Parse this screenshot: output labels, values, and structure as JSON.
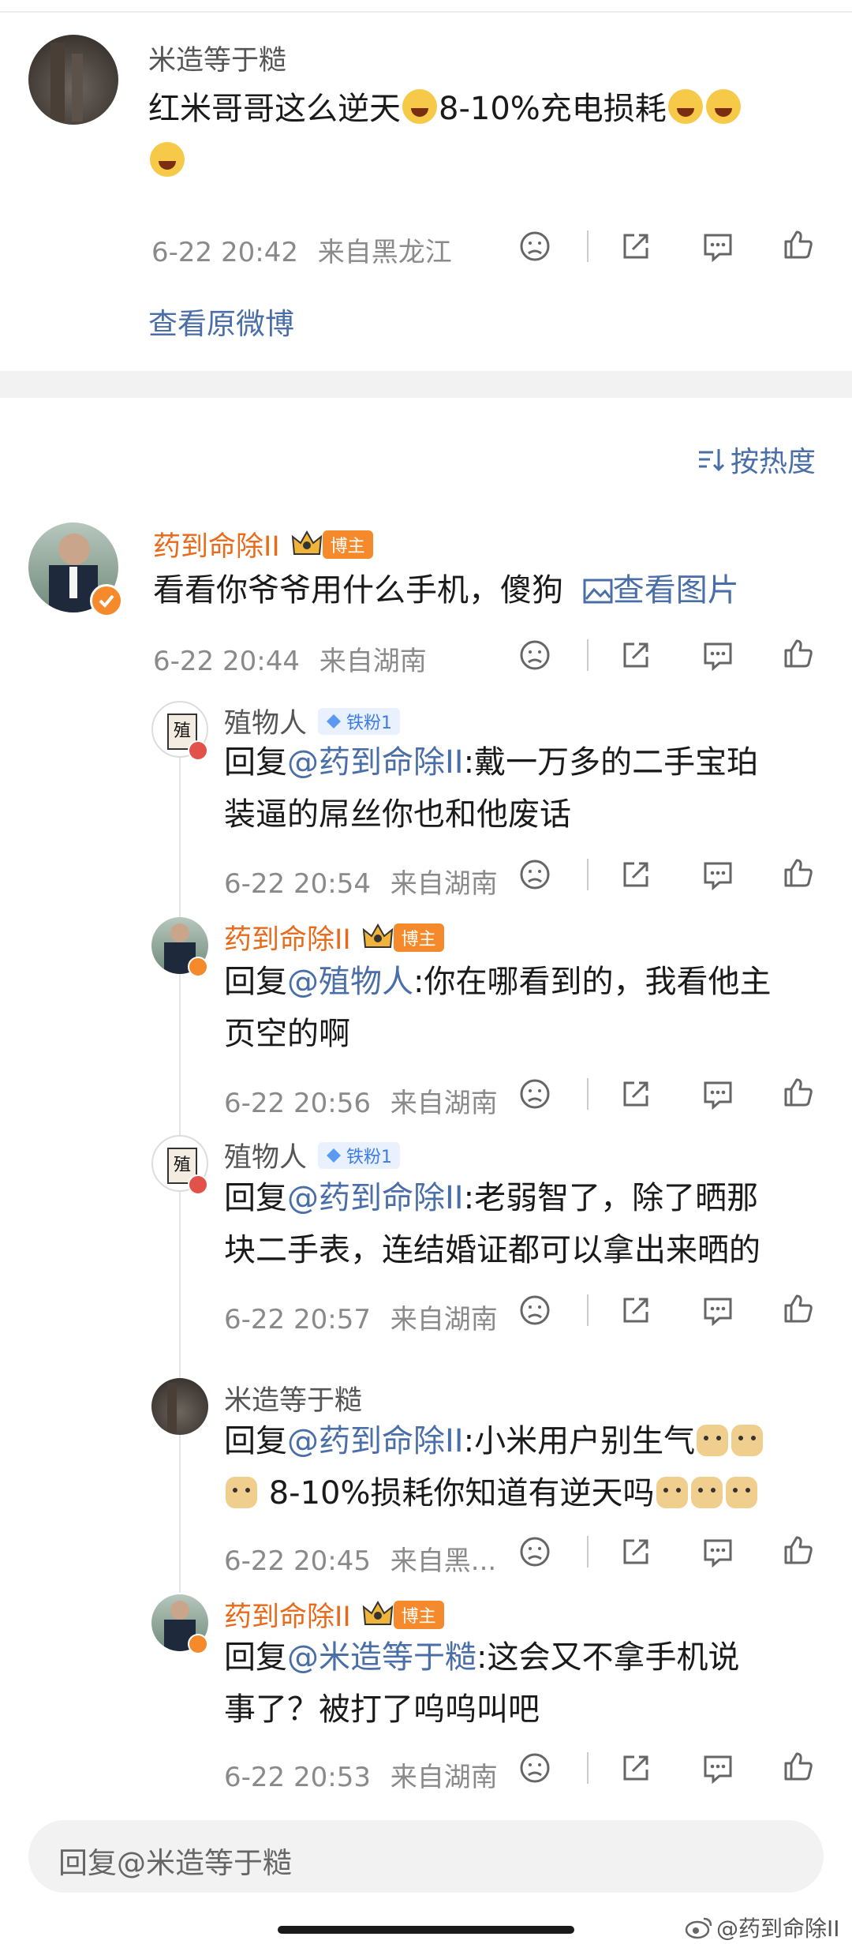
{
  "top_post": {
    "username": "米造等于糙",
    "text_part1": "红米哥哥这么逆天",
    "text_part2": "8-10%充电损耗",
    "time": "6-22 20:42",
    "location": "来自黑龙江",
    "view_original": "查看原微博"
  },
  "sort": {
    "label": "按热度"
  },
  "comment": {
    "username": "药到命除II",
    "badge": "博主",
    "text": "看看你爷爷用什么手机，傻狗",
    "view_image": "查看图片",
    "time": "6-22 20:44",
    "location": "来自湖南"
  },
  "replies": [
    {
      "username": "殖物人",
      "badge": "铁粉1",
      "reply_prefix": "回复",
      "mention": "@药到命除II",
      "line1": ":戴一万多的二手宝珀",
      "line2": "装逼的屌丝你也和他废话",
      "time": "6-22 20:54",
      "location": "来自湖南"
    },
    {
      "username": "药到命除II",
      "badge": "博主",
      "reply_prefix": "回复",
      "mention": "@殖物人",
      "line1": ":你在哪看到的，我看他主",
      "line2": "页空的啊",
      "time": "6-22 20:56",
      "location": "来自湖南"
    },
    {
      "username": "殖物人",
      "badge": "铁粉1",
      "reply_prefix": "回复",
      "mention": "@药到命除II",
      "line1": ":老弱智了，除了晒那",
      "line2": "块二手表，连结婚证都可以拿出来晒的",
      "time": "6-22 20:57",
      "location": "来自湖南"
    },
    {
      "username": "米造等于糙",
      "reply_prefix": "回复",
      "mention": "@药到命除II",
      "line1": ":小米用户别生气",
      "line2": " 8-10%损耗你知道有逆天吗",
      "time": "6-22 20:45",
      "location": "来自黑..."
    },
    {
      "username": "药到命除II",
      "badge": "博主",
      "reply_prefix": "回复",
      "mention": "@米造等于糙",
      "line1": ":这会又不拿手机说",
      "line2": "事了？被打了呜呜叫吧",
      "time": "6-22 20:53",
      "location": "来自湖南"
    }
  ],
  "reply_input": {
    "placeholder": "回复@米造等于糙"
  },
  "watermark": {
    "text": "@药到命除II"
  },
  "colors": {
    "accent_orange": "#e86a1a",
    "link_blue": "#4a6ea8"
  },
  "icons": [
    "dislike-icon",
    "share-icon",
    "comment-icon",
    "like-icon",
    "sort-icon",
    "image-icon",
    "crown-icon",
    "verified-icon"
  ]
}
